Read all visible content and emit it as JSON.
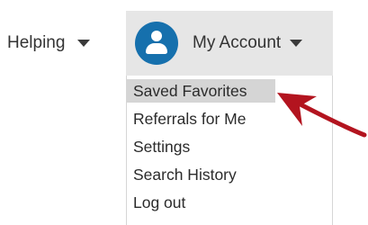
{
  "nav": {
    "helping_label": "Helping",
    "account_label": "My Account",
    "avatar_icon": "user-icon",
    "avatar_color": "#1670ad"
  },
  "dropdown": {
    "items": [
      {
        "label": "Saved Favorites",
        "highlighted": true
      },
      {
        "label": "Referrals for Me"
      },
      {
        "label": "Settings"
      },
      {
        "label": "Search History"
      },
      {
        "label": "Log out"
      }
    ]
  },
  "annotation": {
    "arrow_icon": "red-pointer-arrow-icon",
    "arrow_color": "#b3141f"
  }
}
